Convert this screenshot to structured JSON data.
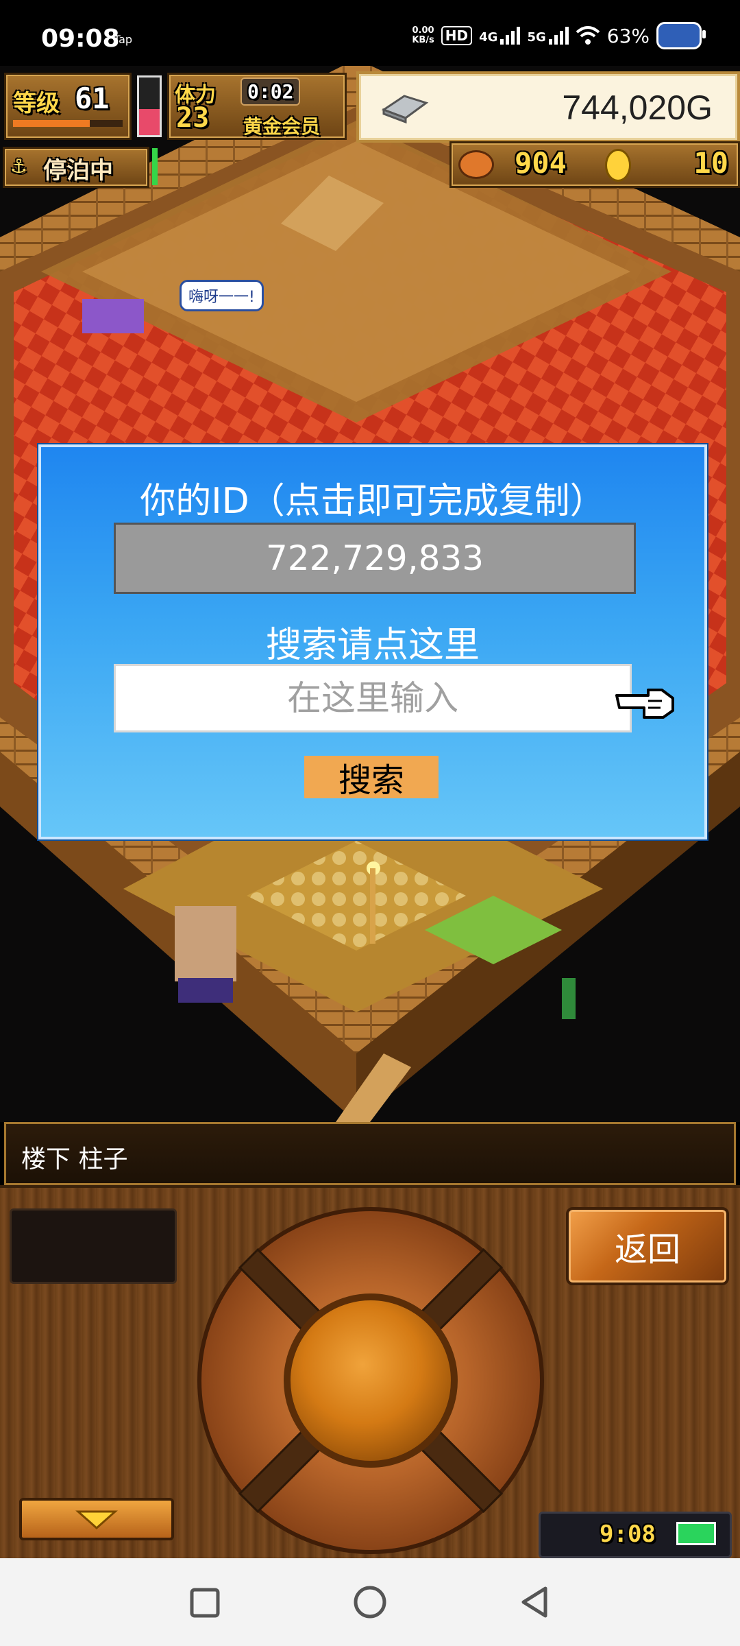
{
  "status_bar": {
    "time": "09:08",
    "app_tag": "Tap",
    "net_speed_top": "0.00",
    "net_speed_bottom": "KB/s",
    "hd_label": "HD",
    "sim1_label": "4G",
    "sim2_label": "5G",
    "battery_percent": "63%"
  },
  "hud": {
    "level_label": "等级",
    "level_value": "61",
    "stamina_label": "体力",
    "stamina_value": "23",
    "timer": "0:02",
    "membership": "黄金会员",
    "gold": "744,020G",
    "anchor_status": "停泊中",
    "food_count": "904",
    "coin_count": "10"
  },
  "scene": {
    "speech_bubble": "嗨呀一一!"
  },
  "dialog": {
    "title": "你的ID（点击即可完成复制）",
    "player_id": "722,729,833",
    "search_label": "搜索请点这里",
    "search_placeholder": "在这里输入",
    "search_button": "搜索"
  },
  "bottom_panel": {
    "location": "楼下 柱子",
    "back_button": "返回",
    "game_clock": "9:08"
  },
  "colors": {
    "dialog_bg": "#2b95f1",
    "search_button_bg": "#f1a851",
    "hud_gold": "#ffd84a",
    "carpet_red": "#d63a1c"
  }
}
